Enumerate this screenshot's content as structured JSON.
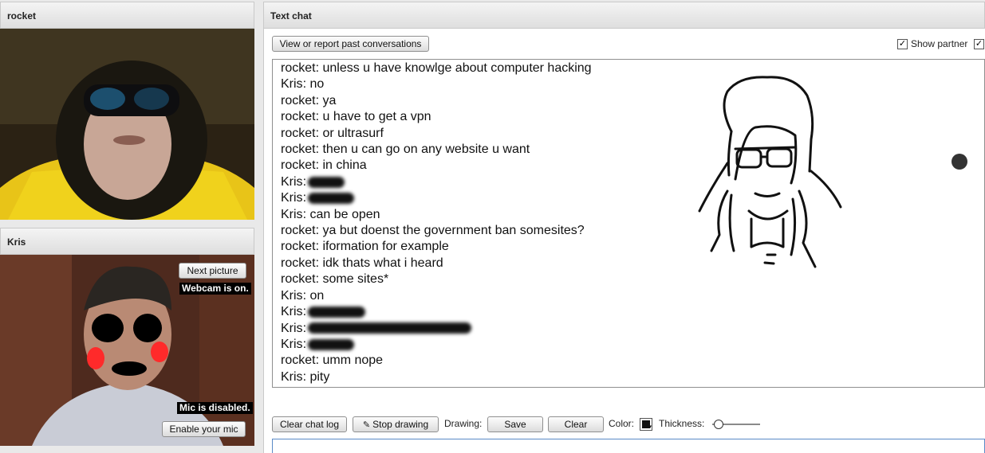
{
  "left": {
    "rocket_panel": {
      "title": "rocket"
    },
    "kris_panel": {
      "title": "Kris",
      "next_picture": "Next picture",
      "webcam_status": "Webcam is on.",
      "mic_status": "Mic is disabled.",
      "enable_mic": "Enable your mic"
    }
  },
  "chat": {
    "title": "Text chat",
    "past_conversations": "View or report past conversations",
    "show_partner": "Show partner",
    "show_partner_checked": true,
    "messages": [
      {
        "user": "rocket",
        "text": " unless u have knowlge about computer hacking"
      },
      {
        "user": "Kris",
        "text": " no"
      },
      {
        "user": "rocket",
        "text": " ya"
      },
      {
        "user": "rocket",
        "text": " u have to get a vpn"
      },
      {
        "user": "rocket",
        "text": " or ultrasurf"
      },
      {
        "user": "rocket",
        "text": " then u can go on any website u want"
      },
      {
        "user": "rocket",
        "text": " in china"
      },
      {
        "user": "Kris",
        "text": ""
      },
      {
        "user": "Kris",
        "text": ""
      },
      {
        "user": "Kris",
        "text": " can be open"
      },
      {
        "user": "rocket",
        "text": " ya but doenst the government ban somesites?"
      },
      {
        "user": "rocket",
        "text": " iformation for example"
      },
      {
        "user": "rocket",
        "text": " idk thats what i heard"
      },
      {
        "user": "rocket",
        "text": " some sites*"
      },
      {
        "user": "Kris",
        "text": " on"
      },
      {
        "user": "Kris",
        "text": ""
      },
      {
        "user": "Kris",
        "text": ""
      },
      {
        "user": "Kris",
        "text": ""
      },
      {
        "user": "rocket",
        "text": " umm nope"
      },
      {
        "user": "Kris",
        "text": " pity"
      }
    ],
    "toolbar": {
      "clear_log": "Clear chat log",
      "stop_drawing": "Stop drawing",
      "drawing_label": "Drawing:",
      "save": "Save",
      "clear": "Clear",
      "color_label": "Color:",
      "thickness_label": "Thickness:"
    },
    "input": {
      "value": ""
    }
  }
}
